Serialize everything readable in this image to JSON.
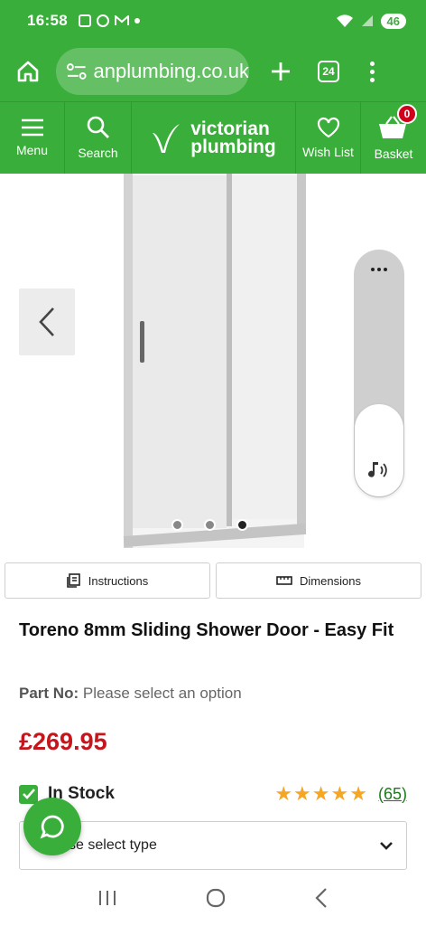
{
  "status": {
    "time": "16:58",
    "battery": "46"
  },
  "browser": {
    "url": "anplumbing.co.uk",
    "tabs": "24"
  },
  "site_nav": {
    "menu": "Menu",
    "search": "Search",
    "logo_line1": "victorian",
    "logo_line2": "plumbing",
    "wishlist": "Wish List",
    "basket": "Basket",
    "basket_count": "0"
  },
  "gallery": {
    "slides": 3,
    "active_slide": 3
  },
  "buttons": {
    "instructions": "Instructions",
    "dimensions": "Dimensions"
  },
  "product": {
    "title": "Toreno 8mm Sliding Shower Door - Easy Fit",
    "part_label": "Part No:",
    "part_value": "Please select an option",
    "price": "£269.95",
    "stock": "In Stock",
    "rating": 5,
    "reviews": "(65)",
    "select_placeholder": "Please select type"
  },
  "colors": {
    "brand_green": "#3aae3a",
    "price_red": "#c4161c",
    "star": "#f5a623"
  }
}
